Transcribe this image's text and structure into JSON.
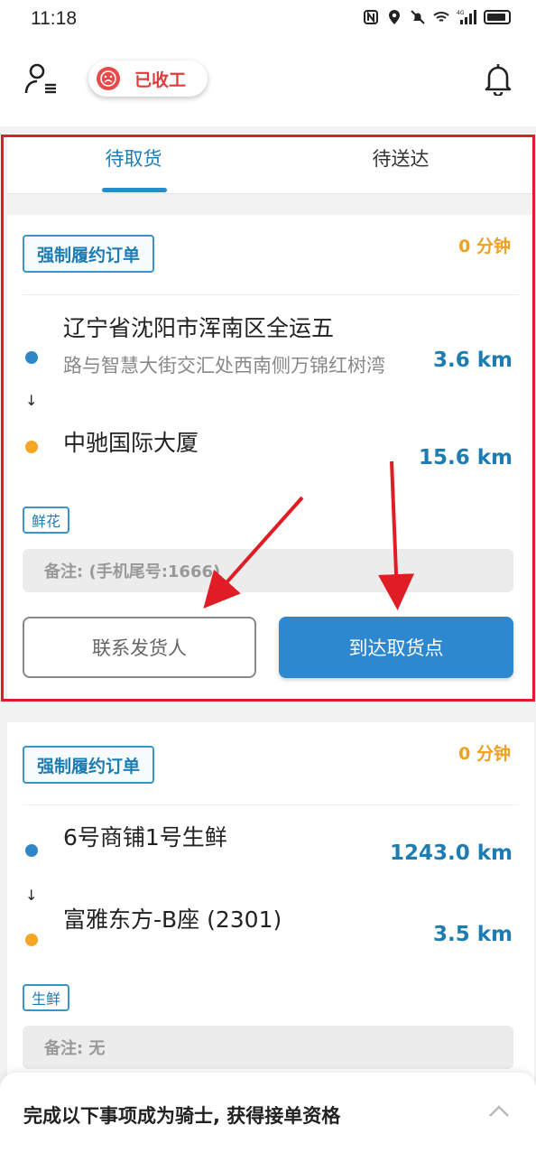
{
  "status_bar": {
    "time": "11:18",
    "network": "4G"
  },
  "top_bar": {
    "work_status": "已收工"
  },
  "tabs": [
    {
      "label": "待取货",
      "active": true
    },
    {
      "label": "待送达",
      "active": false
    }
  ],
  "orders": [
    {
      "badge": "强制履约订单",
      "timer": "0 分钟",
      "pickup": {
        "name": "辽宁省沈阳市浑南区全运五",
        "detail": "路与智慧大街交汇处西南侧万锦红树湾",
        "distance": "3.6 km"
      },
      "dropoff": {
        "name": "中驰国际大厦",
        "distance": "15.6 km"
      },
      "tag": "鲜花",
      "note": "备注: (手机尾号:1666)",
      "buttons": {
        "contact": "联系发货人",
        "arrive": "到达取货点"
      }
    },
    {
      "badge": "强制履约订单",
      "timer": "0 分钟",
      "pickup": {
        "name": "6号商铺1号生鲜",
        "distance": "1243.0 km"
      },
      "dropoff": {
        "name": "富雅东方-B座 (2301)",
        "distance": "3.5 km"
      },
      "tag": "生鲜",
      "note": "备注: 无"
    }
  ],
  "bottom_sheet": {
    "text": "完成以下事项成为骑士, 获得接单资格"
  },
  "colors": {
    "accent": "#2d88cf",
    "warning": "#f0a020",
    "alert": "#e01d25"
  }
}
